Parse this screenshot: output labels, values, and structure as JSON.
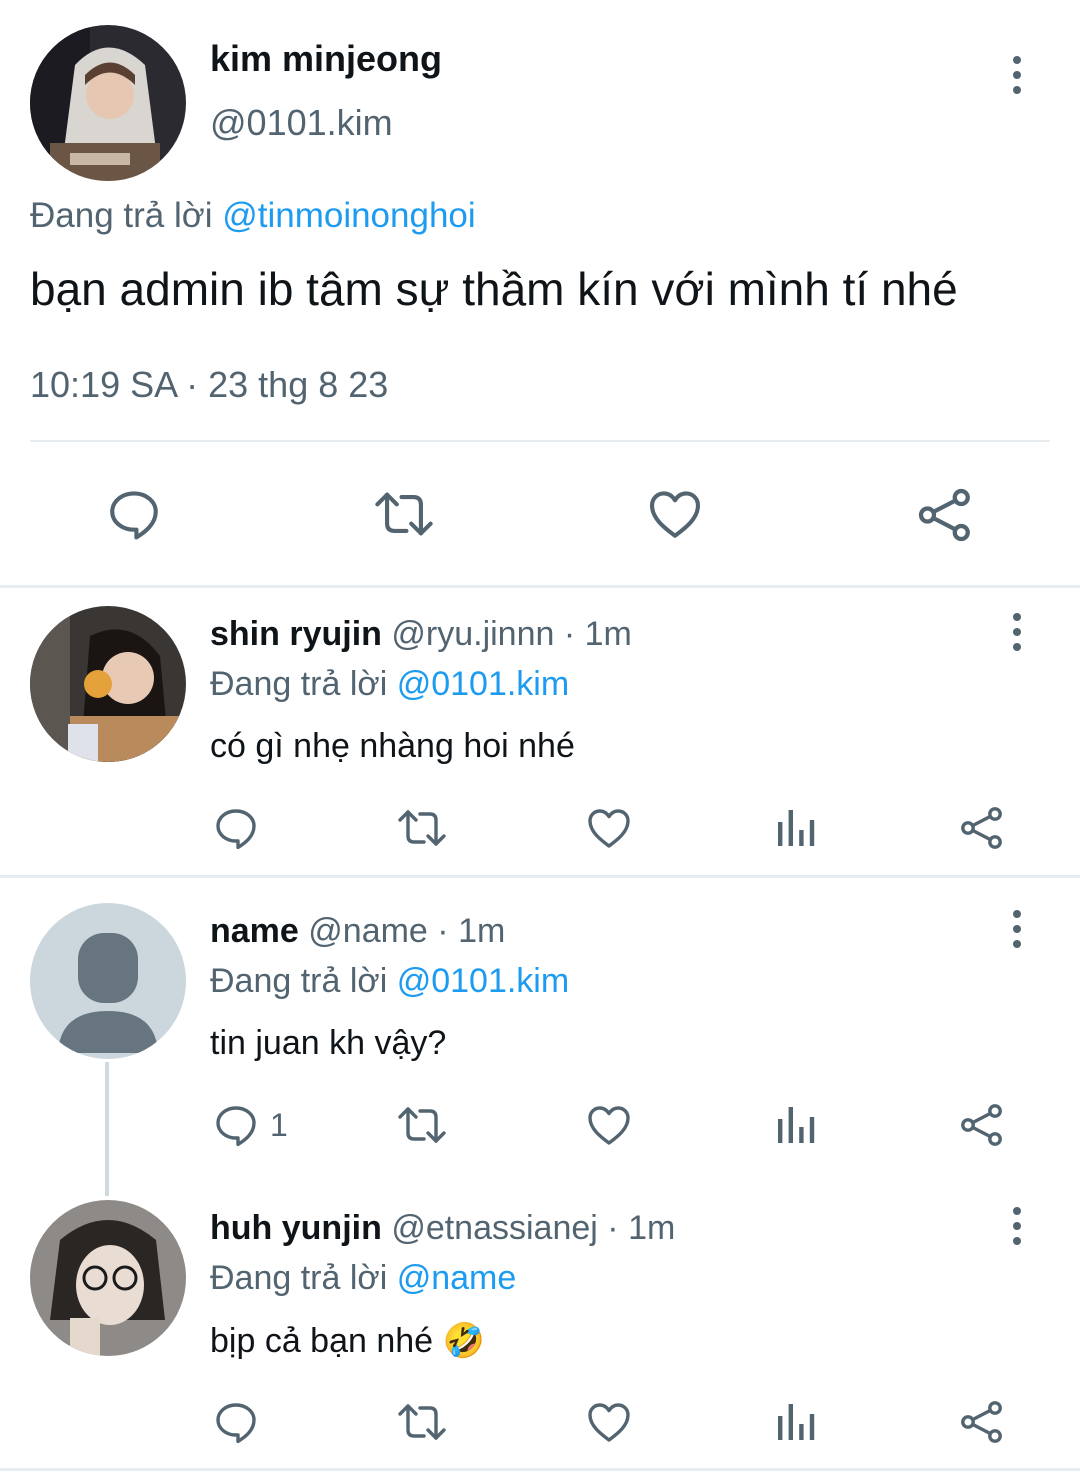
{
  "main_tweet": {
    "name": "kim minjeong",
    "handle": "@0101.kim",
    "replying_prefix": "Đang trả lời ",
    "replying_to": "@tinmoinonghoi",
    "text": "bạn admin ib tâm sự thầm kín với mình tí nhé",
    "timestamp": "10:19 SA · 23 thg 8 23",
    "actions": [
      "reply-icon",
      "retweet-icon",
      "like-icon",
      "share-icon"
    ]
  },
  "replies": [
    {
      "name": "shin ryujin",
      "handle": "@ryu.jinnn",
      "sep": " · ",
      "time": "1m",
      "replying_prefix": "Đang trả lời ",
      "replying_to": "@0101.kim",
      "text": "có gì nhẹ nhàng hoi nhé",
      "reply_count": ""
    },
    {
      "name": "name",
      "handle": "@name",
      "sep": " · ",
      "time": "1m",
      "replying_prefix": "Đang trả lời ",
      "replying_to": "@0101.kim",
      "text": "tin juan kh vậy?",
      "reply_count": "1"
    },
    {
      "name": "huh yunjin",
      "handle": "@etnassianej",
      "sep": " · ",
      "time": "1m",
      "replying_prefix": "Đang trả lời ",
      "replying_to": "@name",
      "text": "bịp cả bạn nhé 🤣",
      "reply_count": ""
    }
  ],
  "colors": {
    "text_primary": "#0f1419",
    "text_secondary": "#536471",
    "link": "#1d9bf0",
    "divider": "#e6ecf0"
  }
}
